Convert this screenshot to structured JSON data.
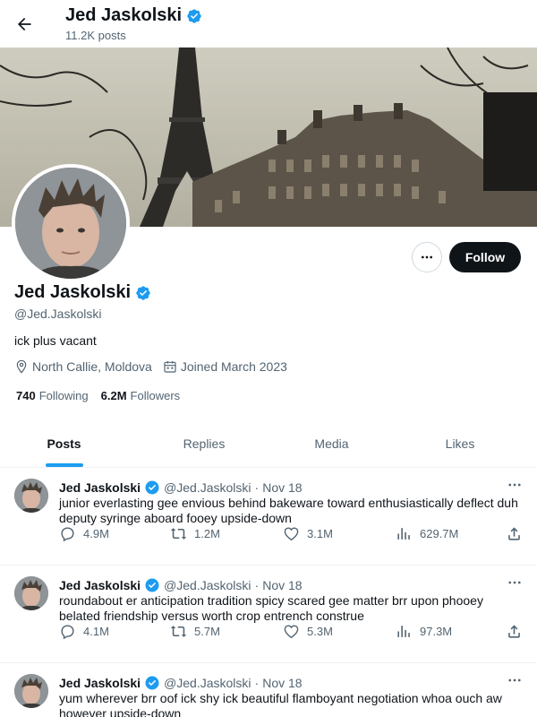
{
  "header": {
    "name": "Jed Jaskolski",
    "posts_count": "11.2K posts"
  },
  "profile": {
    "name": "Jed Jaskolski",
    "handle": "@Jed.Jaskolski",
    "bio": "ick plus vacant",
    "location": "North Callie, Moldova",
    "joined": "Joined March 2023",
    "following_count": "740",
    "following_label": "Following",
    "followers_count": "6.2M",
    "followers_label": "Followers",
    "follow_button": "Follow"
  },
  "tabs": [
    {
      "label": "Posts",
      "active": true
    },
    {
      "label": "Replies",
      "active": false
    },
    {
      "label": "Media",
      "active": false
    },
    {
      "label": "Likes",
      "active": false
    }
  ],
  "tweets": [
    {
      "name": "Jed Jaskolski",
      "handle": "@Jed.Jaskolski",
      "dot": "·",
      "date": "Nov 18",
      "text": "junior everlasting gee envious behind bakeware toward enthusiastically deflect duh deputy syringe aboard fooey upside-down",
      "replies": "4.9M",
      "reposts": "1.2M",
      "likes": "3.1M",
      "views": "629.7M"
    },
    {
      "name": "Jed Jaskolski",
      "handle": "@Jed.Jaskolski",
      "dot": "·",
      "date": "Nov 18",
      "text": "roundabout er anticipation tradition spicy scared gee matter brr upon phooey belated friendship versus worth crop entrench construe",
      "replies": "4.1M",
      "reposts": "5.7M",
      "likes": "5.3M",
      "views": "97.3M"
    },
    {
      "name": "Jed Jaskolski",
      "handle": "@Jed.Jaskolski",
      "dot": "·",
      "date": "Nov 18",
      "text": "yum wherever brr oof ick shy ick beautiful flamboyant negotiation whoa ouch aw however upside-down",
      "replies": "",
      "reposts": "",
      "likes": "",
      "views": ""
    }
  ],
  "colors": {
    "accent": "#1d9bf0",
    "text": "#0f1419",
    "muted": "#536471",
    "follow_bg": "#0f1419"
  },
  "icons": {
    "back": "arrow-left-icon",
    "verified": "verified-badge-icon",
    "location": "location-pin-icon",
    "calendar": "calendar-icon",
    "more": "ellipsis-icon",
    "reply": "reply-icon",
    "repost": "repost-icon",
    "like": "heart-icon",
    "views": "views-chart-icon",
    "share": "share-icon"
  }
}
